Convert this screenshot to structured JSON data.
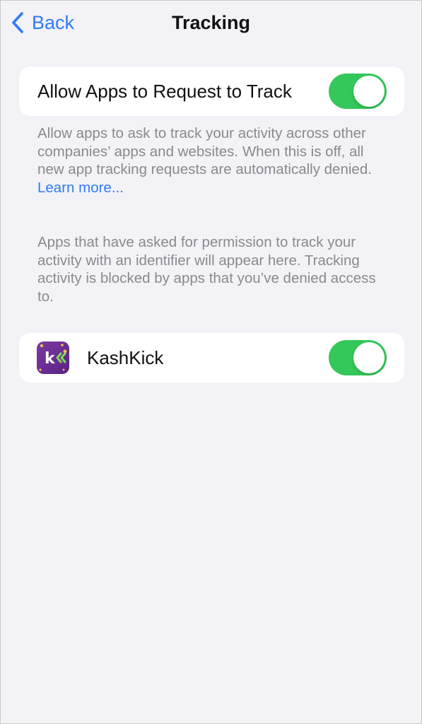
{
  "nav": {
    "back_label": "Back",
    "title": "Tracking"
  },
  "allow_section": {
    "label": "Allow Apps to Request to Track",
    "toggle_on": true
  },
  "allow_footer": {
    "text": "Allow apps to ask to track your activity across other companies’ apps and websites. When this is off, all new app tracking requests are automatically denied. ",
    "link": "Learn more..."
  },
  "apps_footer": {
    "text": "Apps that have asked for permission to track your activity with an identifier will appear here. Tracking activity is blocked by apps that you’ve denied access to."
  },
  "apps": [
    {
      "name": "KashKick",
      "icon": "kashkick-app-icon",
      "icon_letter": "k",
      "toggle_on": true
    }
  ],
  "colors": {
    "accent": "#2f7cf6",
    "toggle_on": "#34c759",
    "background": "#f2f2f7",
    "footnote_text": "#8a8a8e",
    "kashkick_purple": "#6a2c91"
  }
}
